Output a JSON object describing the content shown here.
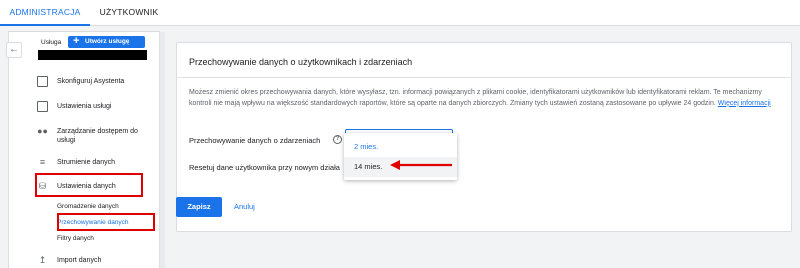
{
  "tabs": [
    {
      "label": "ADMINISTRACJA"
    },
    {
      "label": "UŻYTKOWNIK"
    }
  ],
  "service": {
    "label": "Usługa",
    "create_button": "Utwórz usługę"
  },
  "nav": [
    {
      "label": "Skonfiguruj Asystenta",
      "icon": "checklist-icon"
    },
    {
      "label": "Ustawienia usługi",
      "icon": "property-settings-icon"
    },
    {
      "label": "Zarządzanie dostępem do usługi",
      "label_line1": "Zarządzanie dostępem do",
      "label_line2": "usługi",
      "icon": "people-icon"
    },
    {
      "label": "Strumienie danych",
      "icon": "data-streams-icon"
    },
    {
      "label": "Ustawienia danych",
      "icon": "database-icon"
    },
    {
      "label": "Import danych",
      "icon": "upload-icon"
    }
  ],
  "subnav": [
    {
      "label": "Gromadzenie danych"
    },
    {
      "label": "Przechowywanie danych"
    },
    {
      "label": "Filtry danych"
    }
  ],
  "main": {
    "title": "Przechowywanie danych o użytkownikach i zdarzeniach",
    "description": "Możesz zmienić okres przechowywania danych, które wysyłasz, tzn. informacji powiązanych z plikami cookie, identyfikatorami użytkowników lub identyfikatorami reklam. Te mechanizmy kontroli nie mają wpływu na większość standardowych raportów, które są oparte na danych zbiorczych. Zmiany tych ustawień zostaną zastosowane po upływie 24 godzin.",
    "learn_more": "Więcej informacji",
    "retention_label": "Przechowywanie danych o zdarzeniach",
    "reset_label": "Resetuj dane użytkownika przy nowym działa",
    "options": [
      "2 mies.",
      "14 mies."
    ],
    "save_button": "Zapisz",
    "cancel_button": "Anuluj"
  },
  "colors": {
    "accent": "#1a73e8",
    "highlight": "#e00000"
  }
}
